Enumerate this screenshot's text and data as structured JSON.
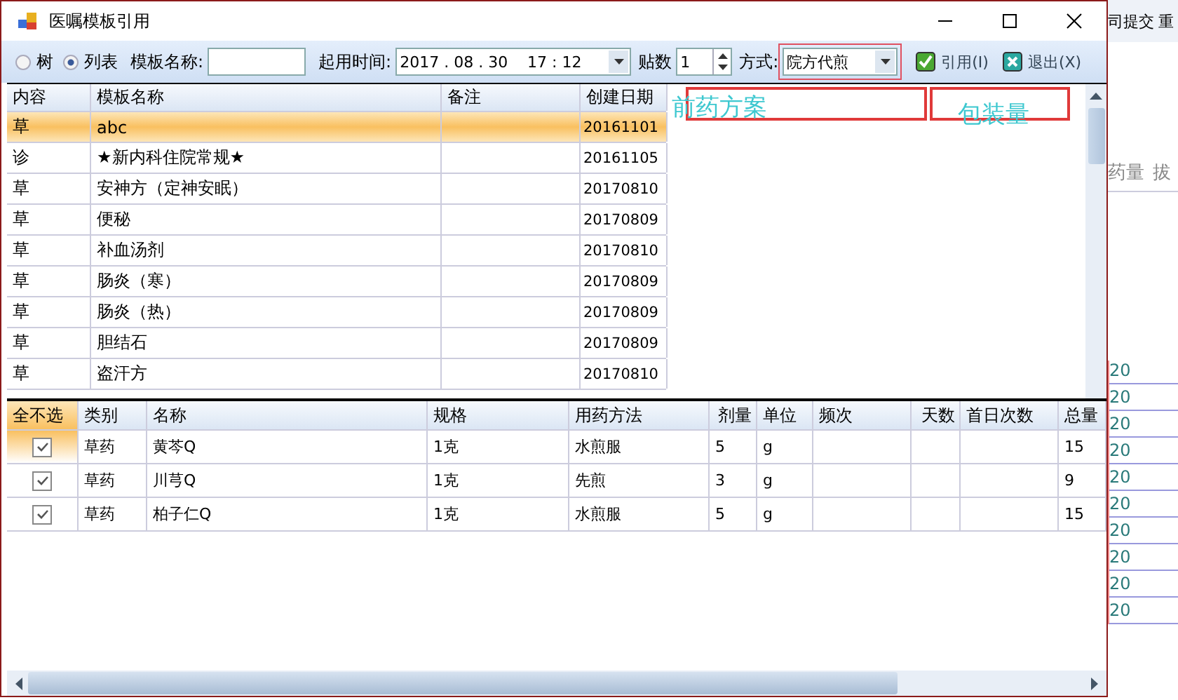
{
  "window": {
    "title": "医嘱模板引用"
  },
  "toolbar": {
    "view_modes": [
      {
        "label": "树",
        "selected": false
      },
      {
        "label": "列表",
        "selected": true
      }
    ],
    "template_name_label": "模板名称:",
    "start_time_label": "起用时间:",
    "start_time": {
      "value": "2017 . 08 . 30    17 : 12"
    },
    "doses_label": "贴数",
    "doses": {
      "value": "1"
    },
    "method_label": "方式:",
    "method": {
      "value": "院方代煎"
    },
    "buttons": [
      {
        "kind": "apply",
        "label": "引用(I)"
      },
      {
        "kind": "exit",
        "label": "退出(X)"
      }
    ]
  },
  "templates_table": {
    "columns": [
      "内容",
      "模板名称",
      "备注",
      "创建日期"
    ],
    "rows": [
      {
        "cells": [
          "草",
          "abc",
          "",
          "20161101"
        ],
        "selected": true
      },
      {
        "cells": [
          "诊",
          "★新内科住院常规★",
          "",
          "20161105"
        ],
        "selected": false
      },
      {
        "cells": [
          "草",
          "安神方（定神安眠）",
          "",
          "20170810"
        ],
        "selected": false
      },
      {
        "cells": [
          "草",
          "便秘",
          "",
          "20170809"
        ],
        "selected": false
      },
      {
        "cells": [
          "草",
          "补血汤剂",
          "",
          "20170810"
        ],
        "selected": false
      },
      {
        "cells": [
          "草",
          "肠炎（寒）",
          "",
          "20170809"
        ],
        "selected": false
      },
      {
        "cells": [
          "草",
          "肠炎（热）",
          "",
          "20170809"
        ],
        "selected": false
      },
      {
        "cells": [
          "草",
          "胆结石",
          "",
          "20170809"
        ],
        "selected": false
      },
      {
        "cells": [
          "草",
          "盗汗方",
          "",
          "20170810"
        ],
        "selected": false
      }
    ]
  },
  "annotations": [
    {
      "text": "前药方案"
    },
    {
      "text": "包装量"
    }
  ],
  "items_table": {
    "select_all": "全不选",
    "columns": [
      "类别",
      "名称",
      "规格",
      "用药方法",
      "剂量",
      "单位",
      "频次",
      "天数",
      "首日次数",
      "总量"
    ],
    "rows": [
      {
        "checked": true,
        "cells": [
          "草药",
          "黄芩Q",
          "1克",
          "水煎服",
          "5",
          "g",
          "",
          "",
          "",
          "15"
        ]
      },
      {
        "checked": true,
        "cells": [
          "草药",
          "川芎Q",
          "1克",
          "先煎",
          "3",
          "g",
          "",
          "",
          "",
          "9"
        ]
      },
      {
        "checked": true,
        "cells": [
          "草药",
          "柏子仁Q",
          "1克",
          "水煎服",
          "5",
          "g",
          "",
          "",
          "",
          "15"
        ]
      }
    ]
  },
  "background_window": {
    "toolbar_text": "司提交",
    "toolbar_text_2": "重",
    "columns": [
      "药量",
      "拔"
    ],
    "cells": [
      "20",
      "20",
      "20",
      "20",
      "20",
      "20",
      "20",
      "20",
      "20",
      "20"
    ]
  }
}
